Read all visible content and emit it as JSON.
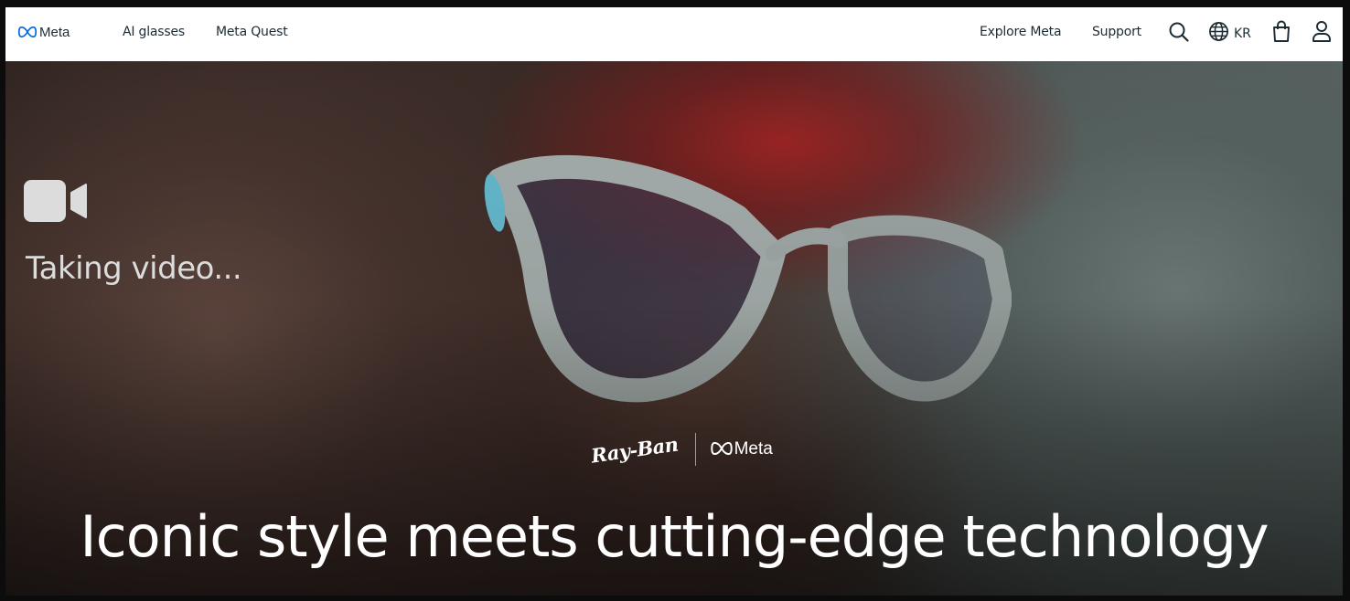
{
  "nav": {
    "brand": "Meta",
    "links": [
      "AI glasses",
      "Meta Quest"
    ],
    "right_links": [
      "Explore Meta",
      "Support"
    ],
    "language_code": "KR",
    "icons": [
      "meta-infinity-icon",
      "search-icon",
      "globe-icon",
      "shopping-bag-icon",
      "account-icon"
    ]
  },
  "hero": {
    "recording_label": "Taking video...",
    "recording_icon": "video-camera-icon",
    "cobrand": {
      "left": "Ray-Ban",
      "right": "Meta"
    },
    "title": "Iconic style meets cutting-edge technology"
  },
  "colors": {
    "nav_bg": "#ffffff",
    "nav_text": "#1c2b33",
    "meta_blue": "#0668e1",
    "hero_text": "#ffffff"
  }
}
